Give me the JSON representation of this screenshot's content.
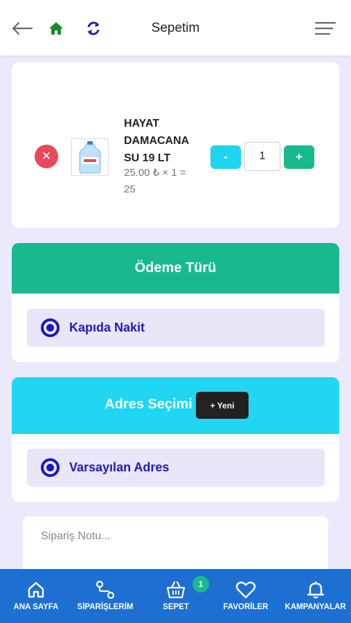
{
  "header": {
    "title": "Sepetim",
    "icons": {
      "back": "arrow-left-icon",
      "home": "home-icon",
      "refresh": "refresh-icon",
      "menu": "hamburger-menu-icon"
    }
  },
  "cart": {
    "items": [
      {
        "name": "HAYAT DAMACANA SU 19 LT",
        "price_line": "25.00 ₺ × 1 = 25",
        "quantity": "1",
        "minus_label": "-",
        "plus_label": "+"
      }
    ]
  },
  "payment": {
    "title": "Ödeme Türü",
    "selected_option": "Kapıda Nakit"
  },
  "address": {
    "title": "Adres Seçimi",
    "new_button": "+ Yeni",
    "selected_option": "Varsayılan Adres"
  },
  "note": {
    "placeholder": "Sipariş Notu..."
  },
  "bottom_nav": {
    "items": [
      {
        "label": "ANA SAYFA",
        "icon": "home-icon"
      },
      {
        "label": "SİPARİŞLERİM",
        "icon": "route-icon"
      },
      {
        "label": "SEPET",
        "icon": "basket-icon",
        "badge": "1"
      },
      {
        "label": "FAVORİLER",
        "icon": "heart-icon"
      },
      {
        "label": "KAMPANYALAR",
        "icon": "bell-icon"
      }
    ]
  },
  "colors": {
    "background": "#ebeafd",
    "green": "#19b98e",
    "cyan": "#21d6f2",
    "blue_nav": "#1e6fd2",
    "radio": "#1b14c6",
    "remove": "#e74a5b"
  }
}
